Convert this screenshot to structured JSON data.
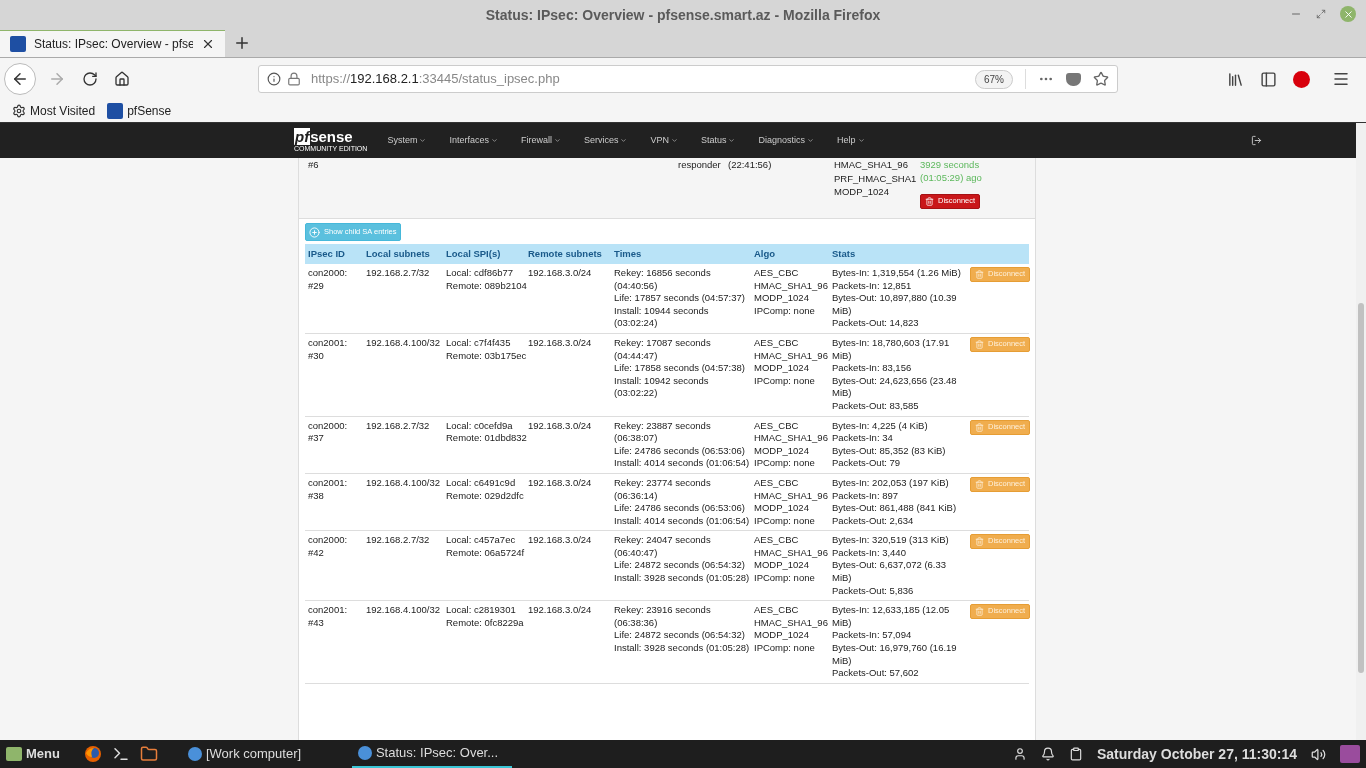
{
  "window": {
    "title": "Status: IPsec: Overview - pfsense.smart.az - Mozilla Firefox"
  },
  "tab": {
    "title": "Status: IPsec: Overview - pfse",
    "selected": true
  },
  "address": {
    "scheme": "https://",
    "host": "192.168.2.1",
    "rest": ":33445/status_ipsec.php",
    "zoom": "67%"
  },
  "bookmarks": [
    "Most Visited",
    "pfSense"
  ],
  "navbar": {
    "logo": "pf",
    "logo_rest": "sense",
    "logo_sub": "COMMUNITY EDITION",
    "items": [
      "System",
      "Interfaces",
      "Firewall",
      "Services",
      "VPN",
      "Status",
      "Diagnostics",
      "Help"
    ]
  },
  "parent_sa": {
    "id": "#6",
    "role": "responder",
    "time": "(22:41:56)",
    "algo": [
      "HMAC_SHA1_96",
      "PRF_HMAC_SHA1",
      "MODP_1024"
    ],
    "status": "3929 seconds (01:05:29) ago",
    "button": "Disconnect"
  },
  "show_child_button": "Show child SA entries",
  "child_table": {
    "columns": [
      "IPsec ID",
      "Local subnets",
      "Local SPI(s)",
      "Remote subnets",
      "Times",
      "Algo",
      "Stats"
    ],
    "rows": [
      {
        "id": "con2000: #29",
        "local_subnet": "192.168.2.7/32",
        "spi": [
          "Local: cdf86b77",
          "Remote: 089b2104"
        ],
        "remote_subnet": "192.168.3.0/24",
        "times": [
          "Rekey: 16856 seconds (04:40:56)",
          "Life: 17857 seconds (04:57:37)",
          "Install: 10944 seconds (03:02:24)"
        ],
        "algo": [
          "AES_CBC",
          "HMAC_SHA1_96",
          "MODP_1024",
          "IPComp: none"
        ],
        "stats": [
          "Bytes-In: 1,319,554 (1.26 MiB)",
          "Packets-In: 12,851",
          "Bytes-Out: 10,897,880 (10.39 MiB)",
          "Packets-Out: 14,823"
        ],
        "button": "Disconnect"
      },
      {
        "id": "con2001: #30",
        "local_subnet": "192.168.4.100/32",
        "spi": [
          "Local: c7f4f435",
          "Remote: 03b175ec"
        ],
        "remote_subnet": "192.168.3.0/24",
        "times": [
          "Rekey: 17087 seconds (04:44:47)",
          "Life: 17858 seconds (04:57:38)",
          "Install: 10942 seconds (03:02:22)"
        ],
        "algo": [
          "AES_CBC",
          "HMAC_SHA1_96",
          "MODP_1024",
          "IPComp: none"
        ],
        "stats": [
          "Bytes-In: 18,780,603 (17.91 MiB)",
          "Packets-In: 83,156",
          "Bytes-Out: 24,623,656 (23.48 MiB)",
          "Packets-Out: 83,585"
        ],
        "button": "Disconnect"
      },
      {
        "id": "con2000: #37",
        "local_subnet": "192.168.2.7/32",
        "spi": [
          "Local: c0cefd9a",
          "Remote: 01dbd832"
        ],
        "remote_subnet": "192.168.3.0/24",
        "times": [
          "Rekey: 23887 seconds (06:38:07)",
          "Life: 24786 seconds (06:53:06)",
          "Install: 4014 seconds (01:06:54)"
        ],
        "algo": [
          "AES_CBC",
          "HMAC_SHA1_96",
          "MODP_1024",
          "IPComp: none"
        ],
        "stats": [
          "Bytes-In: 4,225 (4 KiB)",
          "Packets-In: 34",
          "Bytes-Out: 85,352 (83 KiB)",
          "Packets-Out: 79"
        ],
        "button": "Disconnect"
      },
      {
        "id": "con2001: #38",
        "local_subnet": "192.168.4.100/32",
        "spi": [
          "Local: c6491c9d",
          "Remote: 029d2dfc"
        ],
        "remote_subnet": "192.168.3.0/24",
        "times": [
          "Rekey: 23774 seconds (06:36:14)",
          "Life: 24786 seconds (06:53:06)",
          "Install: 4014 seconds (01:06:54)"
        ],
        "algo": [
          "AES_CBC",
          "HMAC_SHA1_96",
          "MODP_1024",
          "IPComp: none"
        ],
        "stats": [
          "Bytes-In: 202,053 (197 KiB)",
          "Packets-In: 897",
          "Bytes-Out: 861,488 (841 KiB)",
          "Packets-Out: 2,634"
        ],
        "button": "Disconnect"
      },
      {
        "id": "con2000: #42",
        "local_subnet": "192.168.2.7/32",
        "spi": [
          "Local: c457a7ec",
          "Remote: 06a5724f"
        ],
        "remote_subnet": "192.168.3.0/24",
        "times": [
          "Rekey: 24047 seconds (06:40:47)",
          "Life: 24872 seconds (06:54:32)",
          "Install: 3928 seconds (01:05:28)"
        ],
        "algo": [
          "AES_CBC",
          "HMAC_SHA1_96",
          "MODP_1024",
          "IPComp: none"
        ],
        "stats": [
          "Bytes-In: 320,519 (313 KiB)",
          "Packets-In: 3,440",
          "Bytes-Out: 6,637,072 (6.33 MiB)",
          "Packets-Out: 5,836"
        ],
        "button": "Disconnect"
      },
      {
        "id": "con2001: #43",
        "local_subnet": "192.168.4.100/32",
        "spi": [
          "Local: c2819301",
          "Remote: 0fc8229a"
        ],
        "remote_subnet": "192.168.3.0/24",
        "times": [
          "Rekey: 23916 seconds (06:38:36)",
          "Life: 24872 seconds (06:54:32)",
          "Install: 3928 seconds (01:05:28)"
        ],
        "algo": [
          "AES_CBC",
          "HMAC_SHA1_96",
          "MODP_1024",
          "IPComp: none"
        ],
        "stats": [
          "Bytes-In: 12,633,185 (12.05 MiB)",
          "Packets-In: 57,094",
          "Bytes-Out: 16,979,760 (16.19 MiB)",
          "Packets-Out: 57,602"
        ],
        "button": "Disconnect"
      }
    ]
  },
  "taskbar": {
    "menu": "Menu",
    "tasks": [
      {
        "label": "[Work computer]",
        "selected": false
      },
      {
        "label": "Status: IPsec: Over...",
        "selected": true
      }
    ],
    "clock": "Saturday October 27, 11:30:14"
  }
}
